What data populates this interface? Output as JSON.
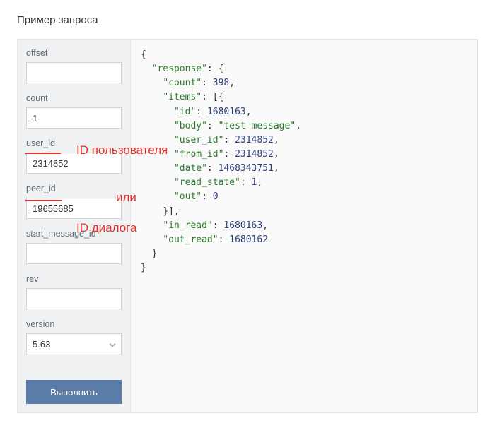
{
  "title": "Пример запроса",
  "sidebar": {
    "fields": {
      "offset": {
        "label": "offset",
        "value": ""
      },
      "count": {
        "label": "count",
        "value": "1"
      },
      "user_id": {
        "label": "user_id",
        "value": "2314852"
      },
      "peer_id": {
        "label": "peer_id",
        "value": "19655685"
      },
      "start_message_id": {
        "label": "start_message_id",
        "value": ""
      },
      "rev": {
        "label": "rev",
        "value": ""
      },
      "version": {
        "label": "version",
        "value": "5.63"
      }
    },
    "execute_label": "Выполнить"
  },
  "response": {
    "count": 398,
    "items": [
      {
        "id": 1680163,
        "body": "test message",
        "user_id": 2314852,
        "from_id": 2314852,
        "date": 1468343751,
        "read_state": 1,
        "out": 0
      }
    ],
    "in_read": 1680163,
    "out_read": 1680162
  },
  "annotations": {
    "user_id_note": "ID пользователя",
    "or": "или",
    "peer_id_note": "ID диалога"
  }
}
